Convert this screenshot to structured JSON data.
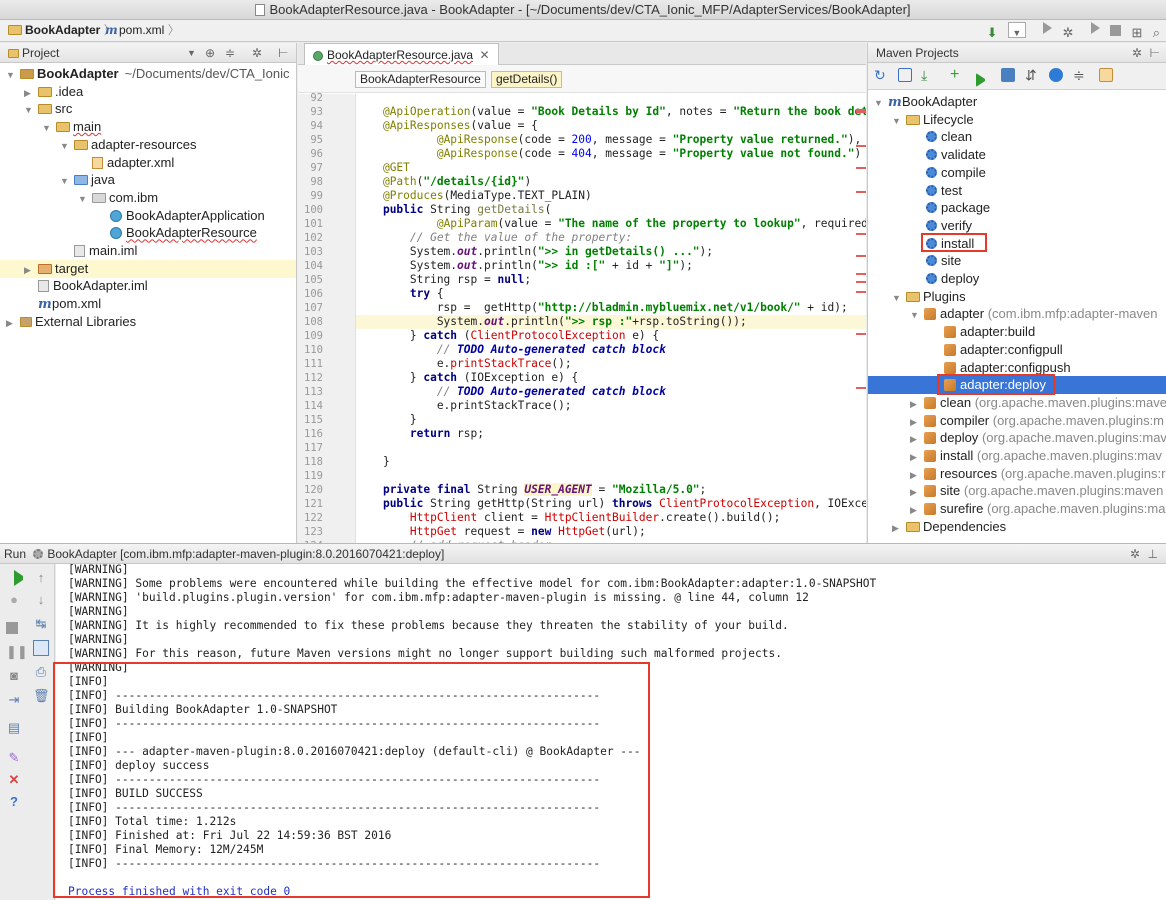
{
  "window": {
    "title": "BookAdapterResource.java - BookAdapter - [~/Documents/dev/CTA_Ionic_MFP/AdapterServices/BookAdapter]"
  },
  "breadcrumb": {
    "project": "BookAdapter",
    "file": "pom.xml"
  },
  "project_panel": {
    "title": "Project",
    "items": [
      {
        "label": "BookAdapter",
        "extra": "~/Documents/dev/CTA_Ionic",
        "icon": "module-folder-icon",
        "arrow": "▼"
      },
      {
        "label": ".idea",
        "icon": "folder-icon",
        "arrow": "▶"
      },
      {
        "label": "src",
        "icon": "folder-icon",
        "arrow": "▼"
      },
      {
        "label": "main",
        "icon": "folder-icon",
        "arrow": "▼"
      },
      {
        "label": "adapter-resources",
        "icon": "folder-icon",
        "arrow": "▼"
      },
      {
        "label": "adapter.xml",
        "icon": "xml-file-icon",
        "arrow": ""
      },
      {
        "label": "java",
        "icon": "source-folder-icon",
        "arrow": "▼"
      },
      {
        "label": "com.ibm",
        "icon": "package-icon",
        "arrow": "▼"
      },
      {
        "label": "BookAdapterApplication",
        "icon": "java-class-icon",
        "arrow": ""
      },
      {
        "label": "BookAdapterResource",
        "icon": "java-class-icon",
        "arrow": ""
      },
      {
        "label": "main.iml",
        "icon": "iml-file-icon",
        "arrow": ""
      },
      {
        "label": "target",
        "icon": "excluded-folder-icon",
        "arrow": "▶"
      },
      {
        "label": "BookAdapter.iml",
        "icon": "iml-file-icon",
        "arrow": ""
      },
      {
        "label": "pom.xml",
        "icon": "maven-file-icon",
        "arrow": ""
      },
      {
        "label": "External Libraries",
        "icon": "library-icon",
        "arrow": "▶"
      }
    ]
  },
  "editor": {
    "tab": "BookAdapterResource.java",
    "breadcrumbs": [
      "BookAdapterResource",
      "getDetails()"
    ],
    "line_numbers": [
      "92",
      "93",
      "94",
      "95",
      "96",
      "97",
      "98",
      "99",
      "100",
      "101",
      "102",
      "103",
      "104",
      "105",
      "106",
      "107",
      "108",
      "109",
      "110",
      "111",
      "112",
      "113",
      "114",
      "115",
      "116",
      "117",
      "118",
      "119",
      "120",
      "121",
      "122",
      "123",
      "124"
    ]
  },
  "maven": {
    "title": "Maven Projects",
    "project": "BookAdapter",
    "lifecycle_label": "Lifecycle",
    "lifecycle": [
      "clean",
      "validate",
      "compile",
      "test",
      "package",
      "verify",
      "install",
      "site",
      "deploy"
    ],
    "plugins_label": "Plugins",
    "plugins": [
      {
        "name": "adapter",
        "detail": "(com.ibm.mfp:adapter-maven",
        "expanded": true,
        "goals": [
          "adapter:build",
          "adapter:configpull",
          "adapter:configpush",
          "adapter:deploy"
        ]
      },
      {
        "name": "clean",
        "detail": "(org.apache.maven.plugins:mave"
      },
      {
        "name": "compiler",
        "detail": "(org.apache.maven.plugins:m"
      },
      {
        "name": "deploy",
        "detail": "(org.apache.maven.plugins:mav"
      },
      {
        "name": "install",
        "detail": "(org.apache.maven.plugins:mav"
      },
      {
        "name": "resources",
        "detail": "(org.apache.maven.plugins:r"
      },
      {
        "name": "site",
        "detail": "(org.apache.maven.plugins:maven"
      },
      {
        "name": "surefire",
        "detail": "(org.apache.maven.plugins:ma"
      }
    ],
    "dependencies_label": "Dependencies",
    "selected": "adapter:deploy"
  },
  "run": {
    "label": "Run",
    "config": "BookAdapter [com.ibm.mfp:adapter-maven-plugin:8.0.2016070421:deploy]",
    "lines": [
      "[WARNING]",
      "[WARNING] Some problems were encountered while building the effective model for com.ibm:BookAdapter:adapter:1.0-SNAPSHOT",
      "[WARNING] 'build.plugins.plugin.version' for com.ibm.mfp:adapter-maven-plugin is missing. @ line 44, column 12",
      "[WARNING]",
      "[WARNING] It is highly recommended to fix these problems because they threaten the stability of your build.",
      "[WARNING]",
      "[WARNING] For this reason, future Maven versions might no longer support building such malformed projects.",
      "[WARNING]",
      "[INFO]",
      "[INFO] ------------------------------------------------------------------------",
      "[INFO] Building BookAdapter 1.0-SNAPSHOT",
      "[INFO] ------------------------------------------------------------------------",
      "[INFO]",
      "[INFO] --- adapter-maven-plugin:8.0.2016070421:deploy (default-cli) @ BookAdapter ---",
      "[INFO] deploy success",
      "[INFO] ------------------------------------------------------------------------",
      "[INFO] BUILD SUCCESS",
      "[INFO] ------------------------------------------------------------------------",
      "[INFO] Total time: 1.212s",
      "[INFO] Finished at: Fri Jul 22 14:59:36 BST 2016",
      "[INFO] Final Memory: 12M/245M",
      "[INFO] ------------------------------------------------------------------------",
      "",
      "Process finished with exit code 0"
    ]
  }
}
